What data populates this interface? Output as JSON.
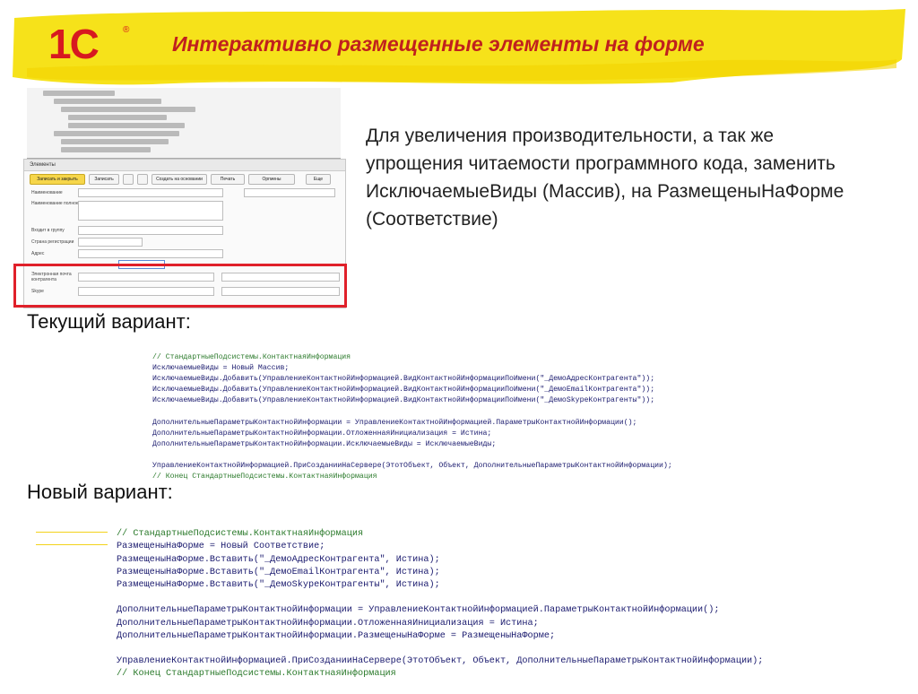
{
  "header": {
    "logo": "1С",
    "title": "Интерактивно размещенные элементы на форме",
    "accent_color": "#f6e21a",
    "title_color": "#c0201e"
  },
  "screenshot": {
    "toolbar": [
      "Записать и закрыть",
      "Записать",
      "Создать на основании",
      "Печать",
      "Оргмены",
      "Еще"
    ],
    "fields": [
      "Наименование",
      "Наименование полное",
      "Входит в группу",
      "Страна регистрации",
      "Адрес",
      "Электронная почта контрагента",
      "Skype"
    ],
    "highlight_color": "#e0202a"
  },
  "description": "Для увеличения производительности, а так же упрощения читаемости программного кода, заменить ИсключаемыеВиды (Массив), на РазмещеныНаФорме (Соответствие)",
  "current": {
    "heading": "Текущий вариант:",
    "code": [
      "// СтандартныеПодсистемы.КонтактнаяИнформация",
      "ИсключаемыеВиды = Новый Массив;",
      "ИсключаемыеВиды.Добавить(УправлениеКонтактнойИнформацией.ВидКонтактнойИнформацииПоИмени(\"_ДемоАдресКонтрагента\"));",
      "ИсключаемыеВиды.Добавить(УправлениеКонтактнойИнформацией.ВидКонтактнойИнформацииПоИмени(\"_ДемоEmailКонтрагента\"));",
      "ИсключаемыеВиды.Добавить(УправлениеКонтактнойИнформацией.ВидКонтактнойИнформацииПоИмени(\"_ДемоSkypeКонтрагенты\"));",
      "",
      "ДополнительныеПараметрыКонтактнойИнформации = УправлениеКонтактнойИнформацией.ПараметрыКонтактнойИнформации();",
      "ДополнительныеПараметрыКонтактнойИнформации.ОтложеннаяИнициализация = Истина;",
      "ДополнительныеПараметрыКонтактнойИнформации.ИсключаемыеВиды = ИсключаемыеВиды;",
      "",
      "УправлениеКонтактнойИнформацией.ПриСозданииНаСервере(ЭтотОбъект, Объект, ДополнительныеПараметрыКонтактнойИнформации);",
      "// Конец СтандартныеПодсистемы.КонтактнаяИнформация"
    ]
  },
  "newer": {
    "heading": "Новый вариант:",
    "code": [
      "// СтандартныеПодсистемы.КонтактнаяИнформация",
      "РазмещеныНаФорме = Новый Соответствие;",
      "РазмещеныНаФорме.Вставить(\"_ДемоАдресКонтрагента\", Истина);",
      "РазмещеныНаФорме.Вставить(\"_ДемоEmailКонтрагента\", Истина);",
      "РазмещеныНаФорме.Вставить(\"_ДемоSkypeКонтрагенты\", Истина);",
      "",
      "ДополнительныеПараметрыКонтактнойИнформации = УправлениеКонтактнойИнформацией.ПараметрыКонтактнойИнформации();",
      "ДополнительныеПараметрыКонтактнойИнформации.ОтложеннаяИнициализация = Истина;",
      "ДополнительныеПараметрыКонтактнойИнформации.РазмещеныНаФорме = РазмещеныНаФорме;",
      "",
      "УправлениеКонтактнойИнформацией.ПриСозданииНаСервере(ЭтотОбъект, Объект, ДополнительныеПараметрыКонтактнойИнформации);",
      "// Конец СтандартныеПодсистемы.КонтактнаяИнформация"
    ]
  }
}
